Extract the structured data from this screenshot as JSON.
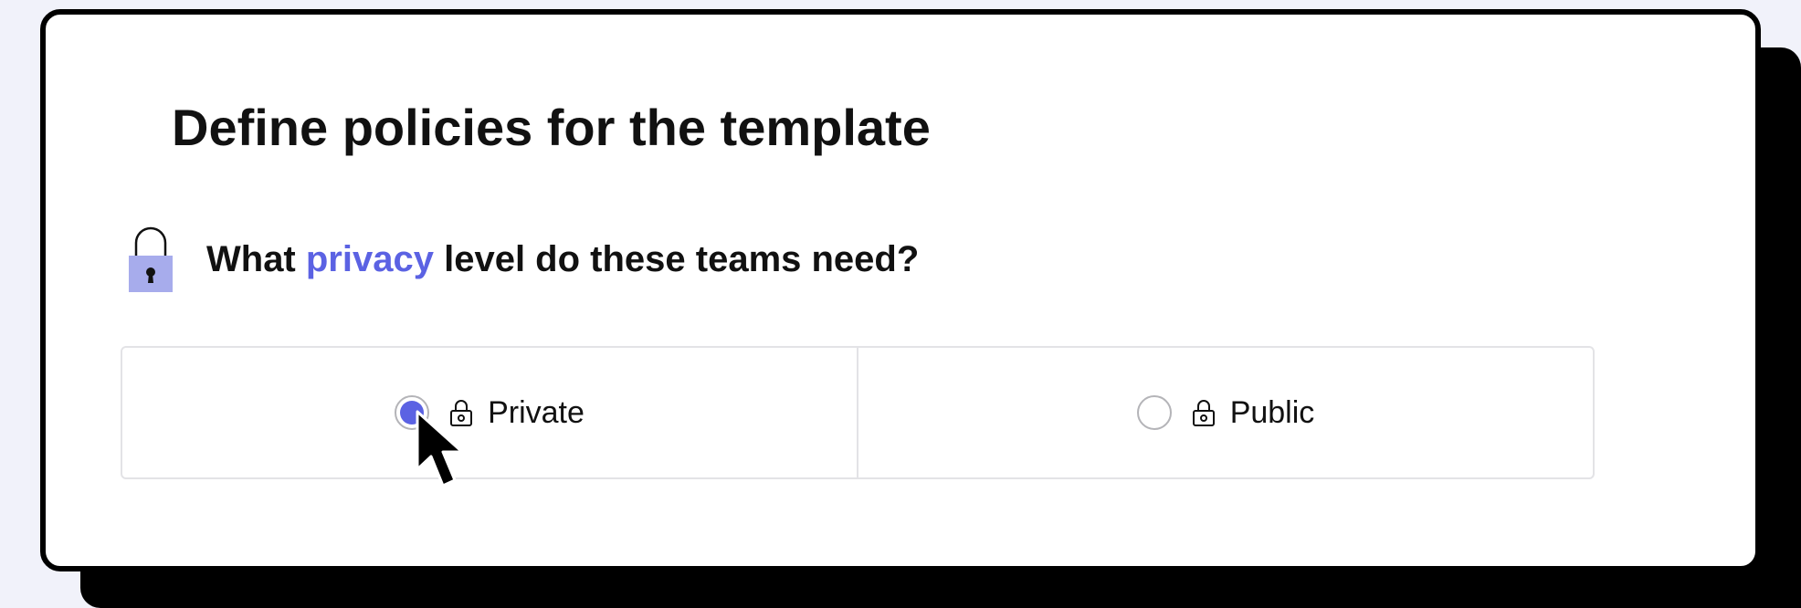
{
  "title": "Define policies for the template",
  "question": {
    "before": "What ",
    "accent": "privacy",
    "after": " level do these teams need?",
    "icon": "padlock-icon"
  },
  "options": [
    {
      "label": "Private",
      "icon": "lock-icon",
      "selected": true
    },
    {
      "label": "Public",
      "icon": "lock-icon",
      "selected": false
    }
  ],
  "colors": {
    "accent": "#5b62e3",
    "lock_body": "#a7acec",
    "card_border": "#000000",
    "background": "#f1f2fa"
  }
}
